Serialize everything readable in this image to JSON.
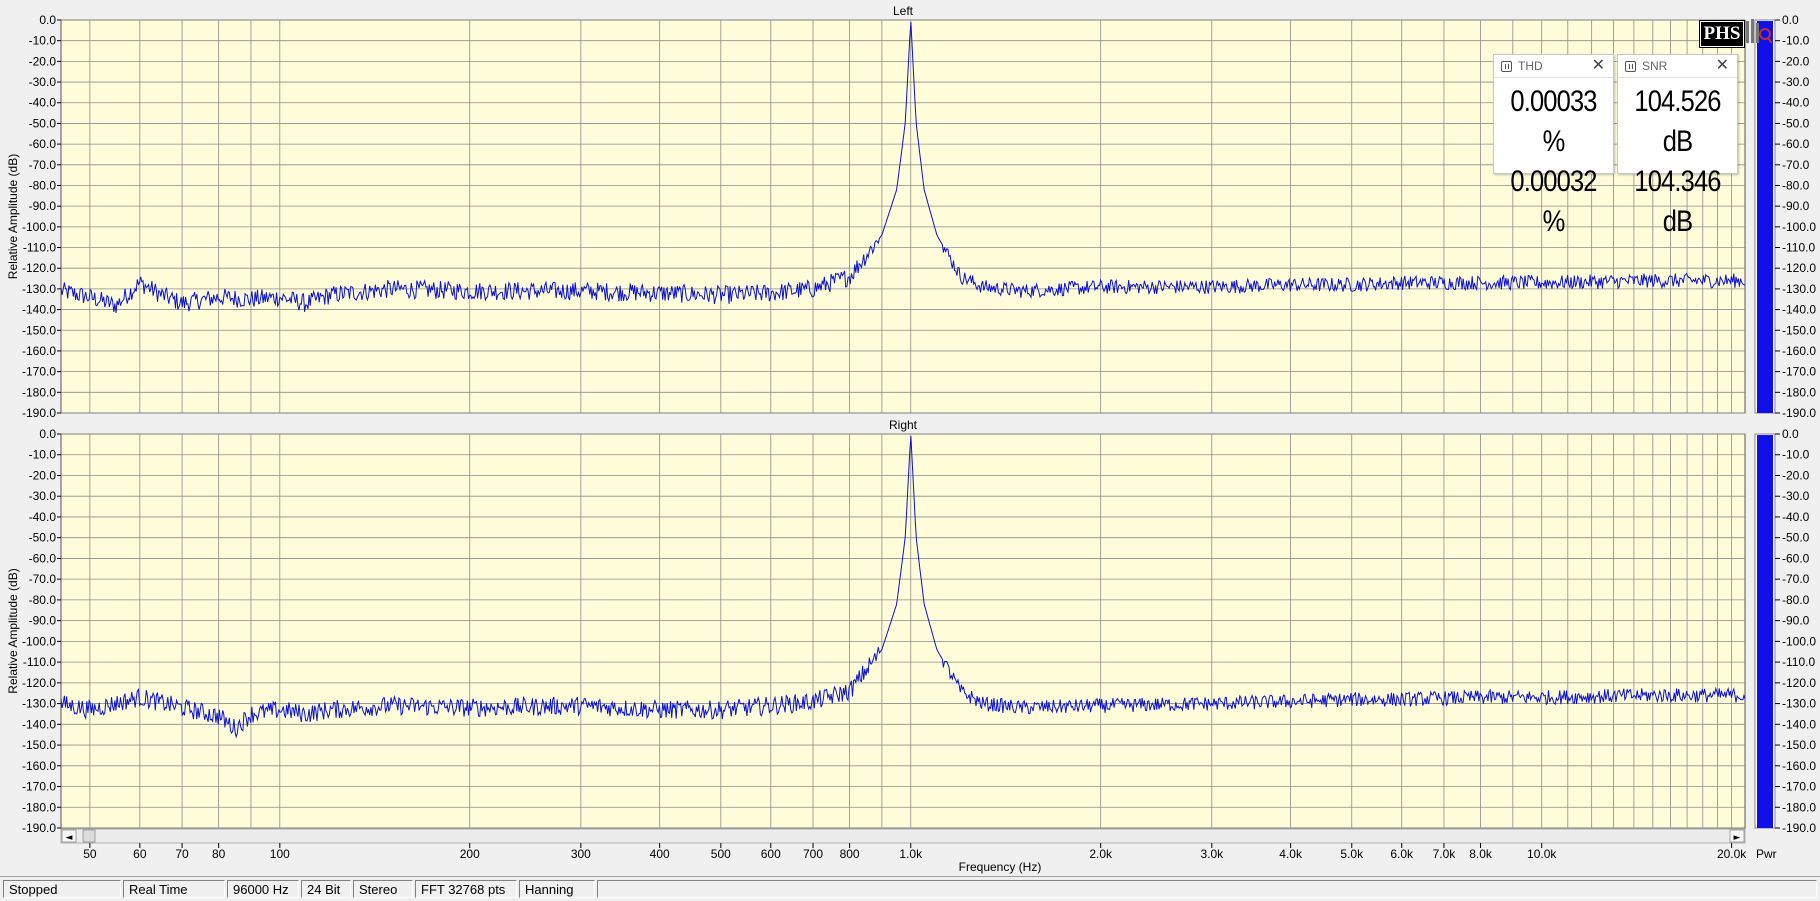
{
  "panels": [
    {
      "title": "Left",
      "ylabel": "Relative Amplitude (dB)"
    },
    {
      "title": "Right",
      "ylabel": "Relative Amplitude (dB)"
    }
  ],
  "xlabel": "Frequency (Hz)",
  "power_label": "Pwr",
  "logo": {
    "text": "PHS"
  },
  "meters": {
    "thd": {
      "label": "THD",
      "values": [
        "0.00033 %",
        "0.00032 %"
      ]
    },
    "snr": {
      "label": "SNR",
      "values": [
        "104.526 dB",
        "104.346 dB"
      ]
    }
  },
  "scroll": {
    "left": "◄",
    "right": "►"
  },
  "status": [
    "Stopped",
    "Real Time",
    "96000 Hz",
    "24 Bit",
    "Stereo",
    "FFT 32768 pts",
    "Hanning",
    ""
  ],
  "colors": {
    "plot_bg": "#fffdd9",
    "trace": "#0a12d6",
    "grid": "#8c8c8c",
    "power_bar": "#1010e8"
  },
  "chart_data": {
    "type": "line",
    "x_scale": "log",
    "xlim": [
      45,
      21000
    ],
    "ylim": [
      -190,
      0
    ],
    "x_ticks": [
      50,
      60,
      70,
      80,
      100,
      200,
      300,
      400,
      500,
      600,
      700,
      800,
      1000,
      2000,
      3000,
      4000,
      5000,
      6000,
      7000,
      8000,
      10000,
      20000
    ],
    "x_tick_labels": [
      "50",
      "60",
      "70",
      "80",
      "100",
      "200",
      "300",
      "400",
      "500",
      "600",
      "700",
      "800",
      "1.0k",
      "2.0k",
      "3.0k",
      "4.0k",
      "5.0k",
      "6.0k",
      "7.0k",
      "8.0k",
      "10.0k",
      "20.0k"
    ],
    "y_ticks": [
      0,
      -10,
      -20,
      -30,
      -40,
      -50,
      -60,
      -70,
      -80,
      -90,
      -100,
      -110,
      -120,
      -130,
      -140,
      -150,
      -160,
      -170,
      -180,
      -190
    ],
    "y_tick_labels": [
      "0.0",
      "-10.0",
      "-20.0",
      "-30.0",
      "-40.0",
      "-50.0",
      "-60.0",
      "-70.0",
      "-80.0",
      "-90.0",
      "-100.0",
      "-110.0",
      "-120.0",
      "-130.0",
      "-140.0",
      "-150.0",
      "-160.0",
      "-170.0",
      "-180.0",
      "-190.0"
    ],
    "series": [
      {
        "name": "Left",
        "peak_freq": 1000,
        "peak_db": 0,
        "noise_floor_db": -130,
        "points": [
          [
            45,
            -131
          ],
          [
            50,
            -134
          ],
          [
            55,
            -138
          ],
          [
            60,
            -127
          ],
          [
            65,
            -133
          ],
          [
            70,
            -137
          ],
          [
            80,
            -134
          ],
          [
            90,
            -135
          ],
          [
            100,
            -134
          ],
          [
            110,
            -137
          ],
          [
            120,
            -133
          ],
          [
            150,
            -130
          ],
          [
            200,
            -131
          ],
          [
            300,
            -131
          ],
          [
            400,
            -132
          ],
          [
            500,
            -133
          ],
          [
            600,
            -132
          ],
          [
            700,
            -130
          ],
          [
            800,
            -124
          ],
          [
            900,
            -104
          ],
          [
            950,
            -82
          ],
          [
            980,
            -50
          ],
          [
            1000,
            0
          ],
          [
            1020,
            -50
          ],
          [
            1050,
            -82
          ],
          [
            1100,
            -104
          ],
          [
            1200,
            -124
          ],
          [
            1300,
            -129
          ],
          [
            1500,
            -131
          ],
          [
            2000,
            -129
          ],
          [
            3000,
            -129
          ],
          [
            4000,
            -128
          ],
          [
            5000,
            -128
          ],
          [
            6000,
            -127
          ],
          [
            8000,
            -127
          ],
          [
            10000,
            -127
          ],
          [
            15000,
            -126
          ],
          [
            21000,
            -126
          ]
        ]
      },
      {
        "name": "Right",
        "peak_freq": 1000,
        "peak_db": 0,
        "noise_floor_db": -130,
        "points": [
          [
            45,
            -130
          ],
          [
            50,
            -133
          ],
          [
            60,
            -127
          ],
          [
            70,
            -132
          ],
          [
            80,
            -136
          ],
          [
            85,
            -142
          ],
          [
            90,
            -135
          ],
          [
            100,
            -133
          ],
          [
            110,
            -135
          ],
          [
            120,
            -133
          ],
          [
            150,
            -131
          ],
          [
            200,
            -132
          ],
          [
            300,
            -131
          ],
          [
            400,
            -133
          ],
          [
            500,
            -133
          ],
          [
            600,
            -131
          ],
          [
            700,
            -129
          ],
          [
            800,
            -124
          ],
          [
            900,
            -104
          ],
          [
            950,
            -82
          ],
          [
            980,
            -50
          ],
          [
            1000,
            0
          ],
          [
            1020,
            -50
          ],
          [
            1050,
            -82
          ],
          [
            1100,
            -104
          ],
          [
            1200,
            -124
          ],
          [
            1300,
            -130
          ],
          [
            1500,
            -132
          ],
          [
            2000,
            -131
          ],
          [
            3000,
            -130
          ],
          [
            4000,
            -129
          ],
          [
            5000,
            -128
          ],
          [
            6000,
            -128
          ],
          [
            8000,
            -127
          ],
          [
            10000,
            -127
          ],
          [
            15000,
            -126
          ],
          [
            21000,
            -126
          ]
        ]
      }
    ],
    "power_levels_db": [
      -0.5,
      -0.5
    ],
    "power_ticks": [
      "0.0",
      "-10.0",
      "-20.0",
      "-30.0",
      "-40.0",
      "-50.0",
      "-60.0",
      "-70.0",
      "-80.0",
      "-90.0",
      "-100.0",
      "-110.0",
      "-120.0",
      "-130.0",
      "-140.0",
      "-150.0",
      "-160.0",
      "-170.0",
      "-180.0",
      "-190.0"
    ]
  }
}
